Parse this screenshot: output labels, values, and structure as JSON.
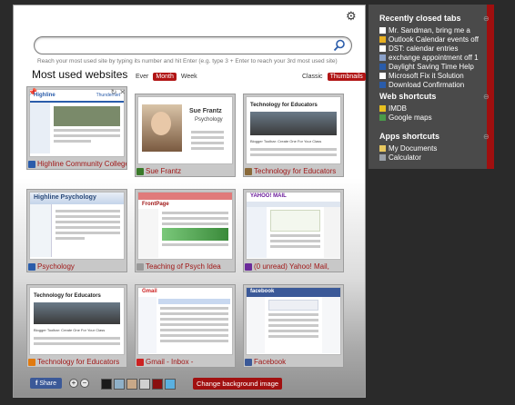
{
  "search": {
    "placeholder": "",
    "hint": "Reach your most used site by typing its number and hit Enter (e.g. type 3 + Enter to reach your 3rd most used site)"
  },
  "most_used": {
    "title": "Most used websites",
    "period": {
      "ever": "Ever",
      "month": "Month",
      "week": "Week",
      "selected": "Month"
    },
    "view": {
      "classic": "Classic",
      "thumbnails": "Thumbnails",
      "selected": "Thumbnails"
    }
  },
  "tiles": [
    {
      "caption": "Highline Community College",
      "favicon_color": "#2a5caa",
      "thumb_heading_1": "Highline",
      "thumb_heading_2": "ThunderNet"
    },
    {
      "caption": "Sue Frantz",
      "favicon_color": "#3a7a2a",
      "thumb_heading_1": "Sue Frantz",
      "thumb_heading_2": "Psychology"
    },
    {
      "caption": "Technology for Educators",
      "favicon_color": "#8a6a3a",
      "thumb_heading_1": "Technology for Educators",
      "thumb_heading_2": "Blogger Toolbar: Create One For Your Class"
    },
    {
      "caption": "Psychology",
      "favicon_color": "#2a5caa",
      "thumb_heading_1": "Highline Psychology",
      "thumb_heading_2": ""
    },
    {
      "caption": "Teaching of Psych Idea",
      "favicon_color": "#999999",
      "thumb_heading_1": "FrontPage",
      "thumb_heading_2": ""
    },
    {
      "caption": "(0 unread) Yahoo! Mail,",
      "favicon_color": "#6a2a9a",
      "thumb_heading_1": "YAHOO! MAIL",
      "thumb_heading_2": ""
    },
    {
      "caption": "Technology for Educators",
      "favicon_color": "#e07a10",
      "thumb_heading_1": "Technology for Educators",
      "thumb_heading_2": "Blogger Toolbar: Create One For Your Class"
    },
    {
      "caption": "Gmail - Inbox -",
      "favicon_color": "#cc2222",
      "thumb_heading_1": "Gmail",
      "thumb_heading_2": ""
    },
    {
      "caption": "Facebook",
      "favicon_color": "#3b5998",
      "thumb_heading_1": "facebook",
      "thumb_heading_2": ""
    }
  ],
  "sidebar": {
    "recently_closed": {
      "title": "Recently closed tabs",
      "items": [
        "Mr. Sandman, bring me a",
        "Outlook Calendar events off",
        "DST: calendar entries",
        "exchange appointment off 1",
        "Daylight Saving Time Help",
        "Microsoft Fix it Solution",
        "Download Confirmation"
      ]
    },
    "web_shortcuts": {
      "title": "Web shortcuts",
      "items": [
        "IMDB",
        "Google maps"
      ]
    },
    "apps_shortcuts": {
      "title": "Apps shortcuts",
      "items": [
        "My Documents",
        "Calculator"
      ]
    }
  },
  "toolbar": {
    "share_label": "Share",
    "change_bg_label": "Change background image",
    "swatches": [
      "#1a1a1a",
      "#8fb0c8",
      "#c8a888",
      "#d0d0d0",
      "#8a1010",
      "#5ab0e0"
    ]
  },
  "colors": {
    "accent": "#b11515",
    "sidebar_bg": "#4a4a4a",
    "page_bg": "#2a2a2a"
  }
}
